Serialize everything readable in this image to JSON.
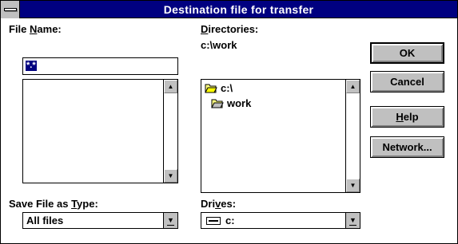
{
  "window": {
    "title": "Destination file for transfer"
  },
  "file_name": {
    "label_pre": "File ",
    "label_key": "N",
    "label_post": "ame:",
    "value": "*.*"
  },
  "directories": {
    "label_key": "D",
    "label_post": "irectories:",
    "current_path": "c:\\work",
    "items": [
      {
        "label": "c:\\",
        "icon": "open-folder-icon"
      },
      {
        "label": "work",
        "icon": "open-folder-icon"
      }
    ]
  },
  "save_type": {
    "label_pre": "Save File as ",
    "label_key": "T",
    "label_post": "ype:",
    "value": "All files"
  },
  "drives": {
    "label_pre": "Dri",
    "label_key": "v",
    "label_post": "es:",
    "value": "c:",
    "icon": "drive-icon"
  },
  "buttons": {
    "ok": "OK",
    "cancel": "Cancel",
    "help_key": "H",
    "help_post": "elp",
    "network": "Network..."
  }
}
